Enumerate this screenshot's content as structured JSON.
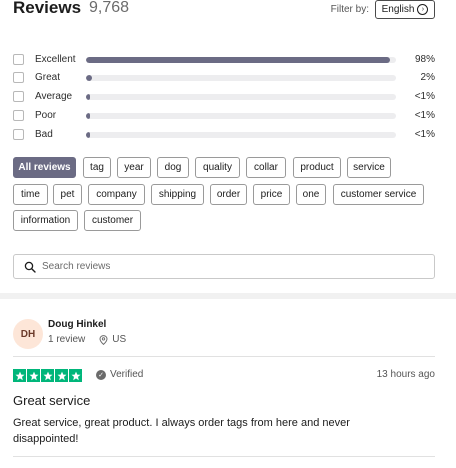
{
  "header": {
    "title": "Reviews",
    "count": "9,768",
    "filter_label": "Filter by:",
    "language": "English"
  },
  "ratings": [
    {
      "label": "Excellent",
      "percent_text": "98%",
      "fill": 0.98
    },
    {
      "label": "Great",
      "percent_text": "2%",
      "fill": 0.02
    },
    {
      "label": "Average",
      "percent_text": "<1%",
      "fill": 0.008
    },
    {
      "label": "Poor",
      "percent_text": "<1%",
      "fill": 0.006
    },
    {
      "label": "Bad",
      "percent_text": "<1%",
      "fill": 0.006
    }
  ],
  "colors": {
    "bar_fill": "#6b6b84",
    "bar_track": "#ededef",
    "star_green": "#00b67a",
    "avatar_bg": "#fde6d8"
  },
  "tags": [
    "All reviews",
    "tag",
    "year",
    "dog",
    "quality",
    "collar",
    "product",
    "service",
    "time",
    "pet",
    "company",
    "shipping",
    "order",
    "price",
    "one",
    "customer service",
    "information",
    "customer"
  ],
  "search": {
    "placeholder": "Search reviews",
    "icon": "search-icon"
  },
  "review": {
    "avatar_initials": "DH",
    "reviewer_name": "Doug Hinkel",
    "review_count": "1 review",
    "country": "US",
    "stars": 5,
    "verified_label": "Verified",
    "time": "13 hours ago",
    "title": "Great service",
    "body": "Great service, great product. I always order tags from here and never disappointed!"
  }
}
